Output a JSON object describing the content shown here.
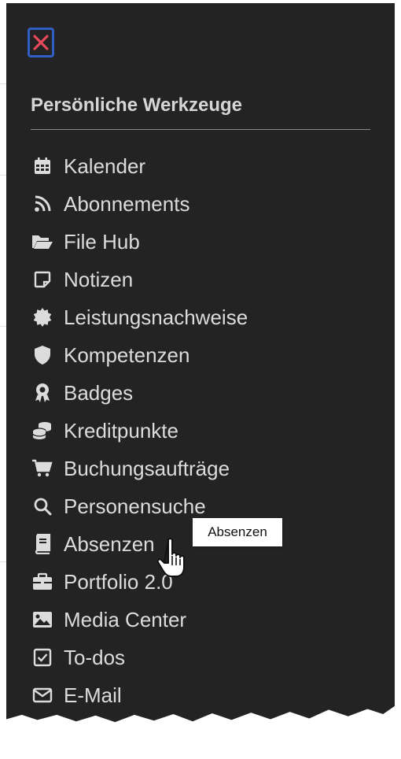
{
  "close_icon": "close-x-icon",
  "panel": {
    "heading": "Persönliche Werkzeuge",
    "items": [
      {
        "label": "Kalender",
        "icon": "calendar-icon"
      },
      {
        "label": "Abonnements",
        "icon": "rss-icon"
      },
      {
        "label": "File Hub",
        "icon": "folder-open-icon"
      },
      {
        "label": "Notizen",
        "icon": "sticky-note-icon"
      },
      {
        "label": "Leistungsnachweise",
        "icon": "certificate-icon"
      },
      {
        "label": "Kompetenzen",
        "icon": "shield-icon"
      },
      {
        "label": "Badges",
        "icon": "award-icon"
      },
      {
        "label": "Kreditpunkte",
        "icon": "coins-icon"
      },
      {
        "label": "Buchungsaufträge",
        "icon": "cart-icon"
      },
      {
        "label": "Personensuche",
        "icon": "search-icon"
      },
      {
        "label": "Absenzen",
        "icon": "book-icon"
      },
      {
        "label": "Portfolio 2.0",
        "icon": "briefcase-icon"
      },
      {
        "label": "Media Center",
        "icon": "image-icon"
      },
      {
        "label": "To-dos",
        "icon": "checkbox-icon"
      },
      {
        "label": "E-Mail",
        "icon": "envelope-icon"
      }
    ]
  },
  "tooltip": {
    "text": "Absenzen"
  },
  "colors": {
    "panel_bg": "#232323",
    "text": "#dcdcdc",
    "close_border": "#2f5fc4",
    "close_x": "#e8495c"
  }
}
